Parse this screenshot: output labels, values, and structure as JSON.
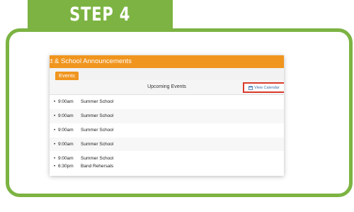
{
  "step": {
    "title": "STEP 4"
  },
  "announcements": {
    "title": "ct & School Announcements",
    "tab_label": "Events",
    "panel_title": "Upcoming Events",
    "view_calendar_label": "View Calendar",
    "rows": [
      [
        {
          "time": "9:00am",
          "name": "Summer School"
        }
      ],
      [
        {
          "time": "9:00am",
          "name": "Summer School"
        }
      ],
      [
        {
          "time": "9:00am",
          "name": "Summer School"
        }
      ],
      [
        {
          "time": "9:00am",
          "name": "Summer School"
        }
      ],
      [
        {
          "time": "9:00am",
          "name": "Summer School"
        },
        {
          "time": "6:30pm",
          "name": "Band Rehersals"
        }
      ]
    ]
  },
  "colors": {
    "green": "#7cb342",
    "orange": "#f0951e",
    "highlight": "#d93a2b",
    "link": "#3a6fb0"
  }
}
